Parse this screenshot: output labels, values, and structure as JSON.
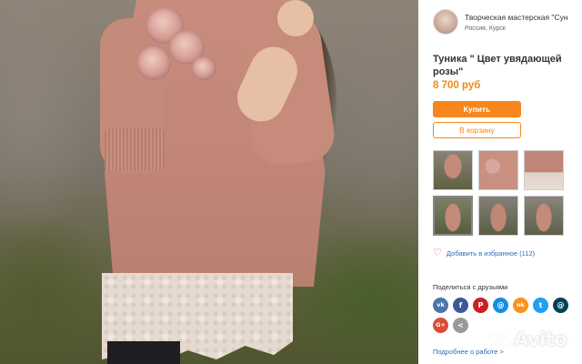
{
  "seller": {
    "name": "Творческая мастерская \"Сун",
    "location": "Россия, Курск"
  },
  "product": {
    "title": "Туника \" Цвет увядающей розы\"",
    "price": "8 700 руб"
  },
  "actions": {
    "buy_label": "Купить",
    "cart_label": "В корзину"
  },
  "gallery": {
    "thumbnails": [
      "thumb-1",
      "thumb-2",
      "thumb-3",
      "thumb-4",
      "thumb-5",
      "thumb-6"
    ],
    "selected_index": 3
  },
  "favorites": {
    "label": "Добавить в избранное (112)",
    "icon": "heart-outline-icon"
  },
  "share": {
    "title": "Поделиться с друзьями",
    "networks": [
      {
        "name": "vk",
        "glyph": "vk",
        "color": "#4a76a8"
      },
      {
        "name": "facebook",
        "glyph": "f",
        "color": "#3b5998"
      },
      {
        "name": "pinterest",
        "glyph": "P",
        "color": "#cb2027"
      },
      {
        "name": "moy-mir",
        "glyph": "@",
        "color": "#168de2"
      },
      {
        "name": "odnoklassniki",
        "glyph": "ok",
        "color": "#f7931e"
      },
      {
        "name": "twitter",
        "glyph": "t",
        "color": "#1da1f2"
      },
      {
        "name": "livejournal",
        "glyph": "@",
        "color": "#004359"
      },
      {
        "name": "google-plus",
        "glyph": "G+",
        "color": "#dd4b39"
      },
      {
        "name": "share",
        "glyph": "<",
        "color": "#9a9a9a"
      }
    ]
  },
  "more_link": "Подробнее о работе >",
  "watermark": "Avito",
  "colors": {
    "accent": "#f7861c",
    "price": "#f28a13",
    "link": "#2a6cc2"
  }
}
